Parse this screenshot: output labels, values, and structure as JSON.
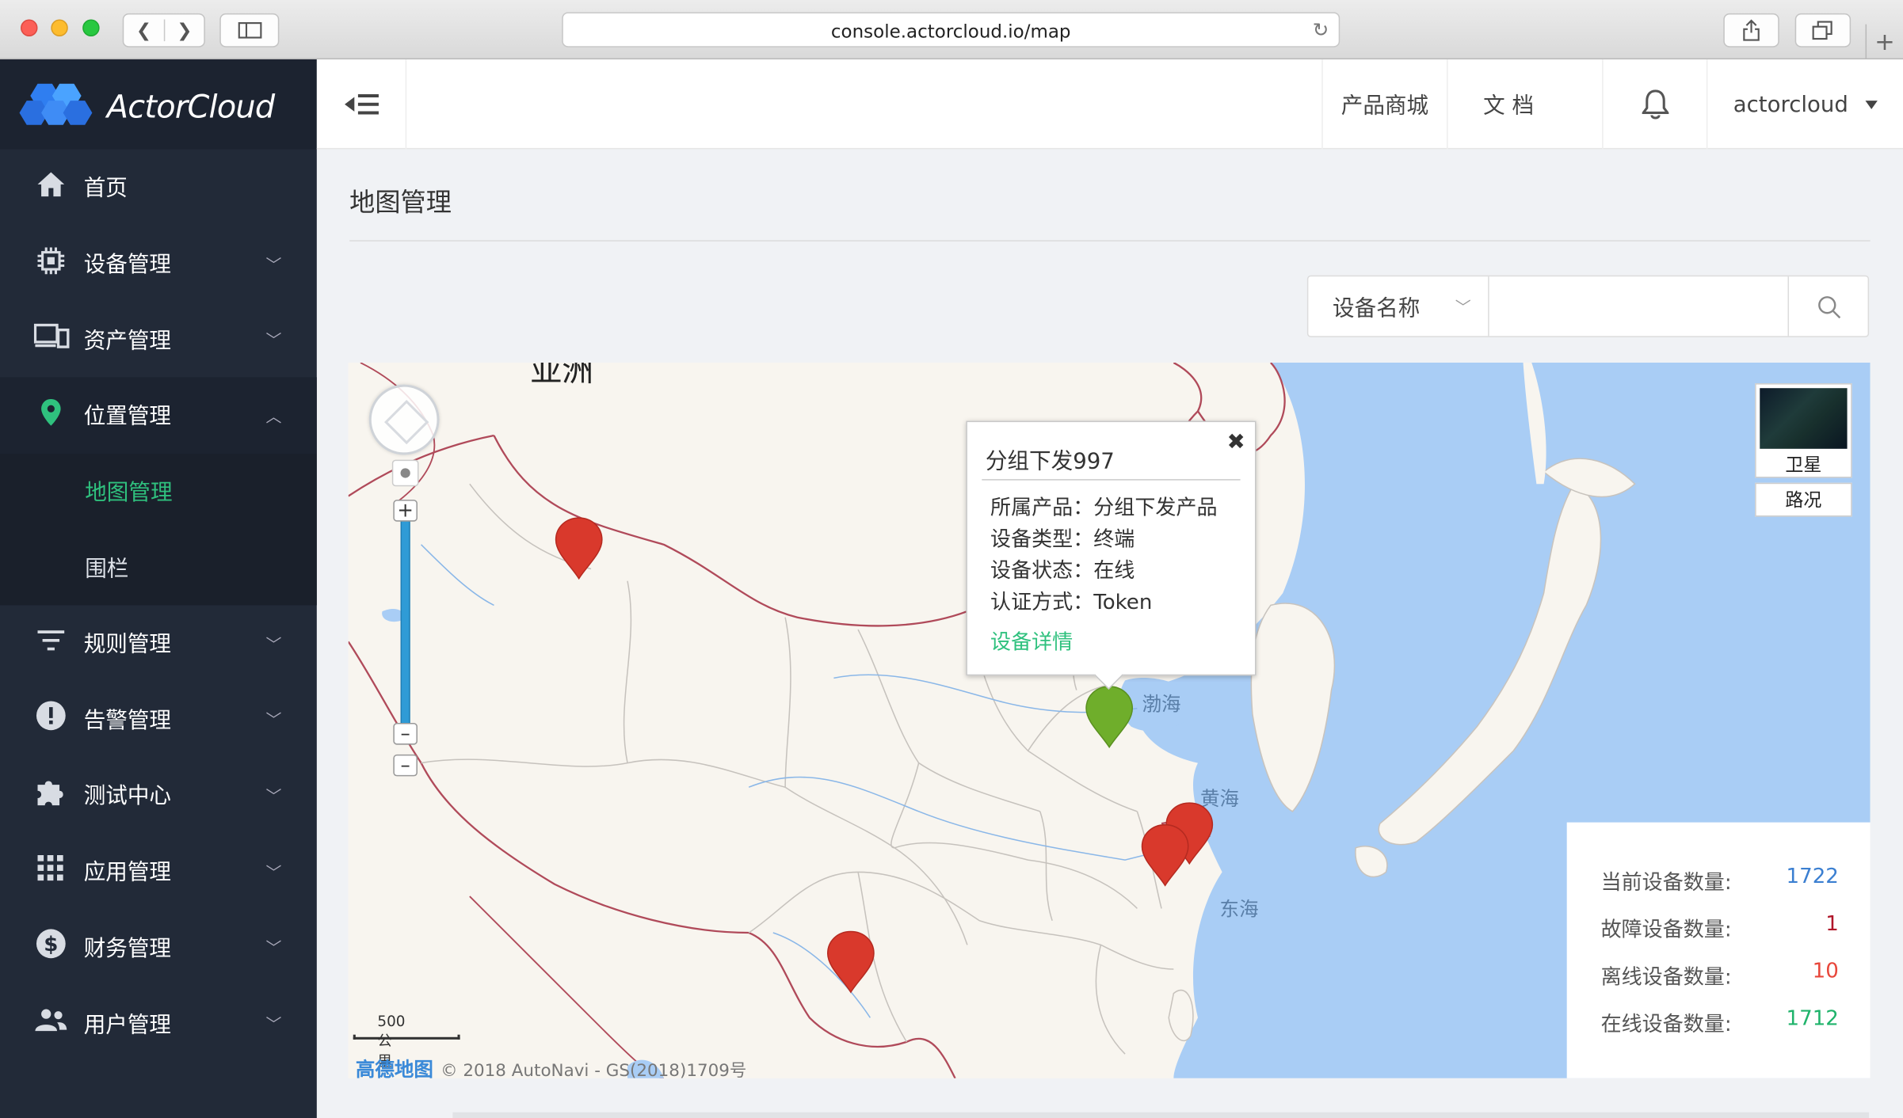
{
  "browser": {
    "url": "console.actorcloud.io/map",
    "icons": [
      "back-icon",
      "forward-icon",
      "sidebar-icon",
      "reload-icon",
      "share-icon",
      "tabs-icon",
      "plus-icon"
    ]
  },
  "brand": {
    "name": "ActorCloud",
    "accent": "#2fc17e",
    "sidebar_bg": "#222a38"
  },
  "sidebar": {
    "items": [
      {
        "label": "首页",
        "icon": "home-icon"
      },
      {
        "label": "设备管理",
        "icon": "chip-icon"
      },
      {
        "label": "资产管理",
        "icon": "devices-icon"
      },
      {
        "label": "位置管理",
        "icon": "location-pin-icon",
        "expanded": true,
        "children": [
          {
            "label": "地图管理",
            "active": true
          },
          {
            "label": "围栏"
          }
        ]
      },
      {
        "label": "规则管理",
        "icon": "filter-icon"
      },
      {
        "label": "告警管理",
        "icon": "alert-icon"
      },
      {
        "label": "测试中心",
        "icon": "puzzle-icon"
      },
      {
        "label": "应用管理",
        "icon": "grid-icon"
      },
      {
        "label": "财务管理",
        "icon": "dollar-icon"
      },
      {
        "label": "用户管理",
        "icon": "users-icon"
      }
    ]
  },
  "header": {
    "mall": "产品商城",
    "docs": "文 档",
    "user": "actorcloud"
  },
  "page": {
    "title": "地图管理"
  },
  "search": {
    "field": "设备名称",
    "placeholder": ""
  },
  "map": {
    "continent_label": "亚洲",
    "sea_labels": {
      "bohai": "渤海",
      "yellow": "黄海",
      "east": "东海"
    },
    "layers": {
      "satellite": "卫星",
      "traffic": "路况"
    },
    "scale": "500 公里",
    "provider": "高德地图",
    "copyright": "© 2018 AutoNavi - GS(2018)1709号",
    "pins": [
      {
        "status": "offline",
        "color": "#d9392c"
      },
      {
        "status": "online",
        "color": "#6fae2b"
      },
      {
        "status": "offline",
        "color": "#d9392c"
      },
      {
        "status": "offline",
        "color": "#d9392c"
      },
      {
        "status": "offline",
        "color": "#d9392c"
      }
    ]
  },
  "popup": {
    "title": "分组下发997",
    "close": "✖",
    "rows": [
      {
        "label": "所属产品：",
        "value": "分组下发产品"
      },
      {
        "label": "设备类型：",
        "value": "终端"
      },
      {
        "label": "设备状态：",
        "value": "在线"
      },
      {
        "label": "认证方式：",
        "value": "Token"
      }
    ],
    "link": "设备详情"
  },
  "stats": [
    {
      "label": "当前设备数量:",
      "value": "1722",
      "color": "#3b7fd1"
    },
    {
      "label": "故障设备数量:",
      "value": "1",
      "color": "#b0162a"
    },
    {
      "label": "离线设备数量:",
      "value": "10",
      "color": "#e8473b"
    },
    {
      "label": "在线设备数量:",
      "value": "1712",
      "color": "#1fb36b"
    }
  ]
}
